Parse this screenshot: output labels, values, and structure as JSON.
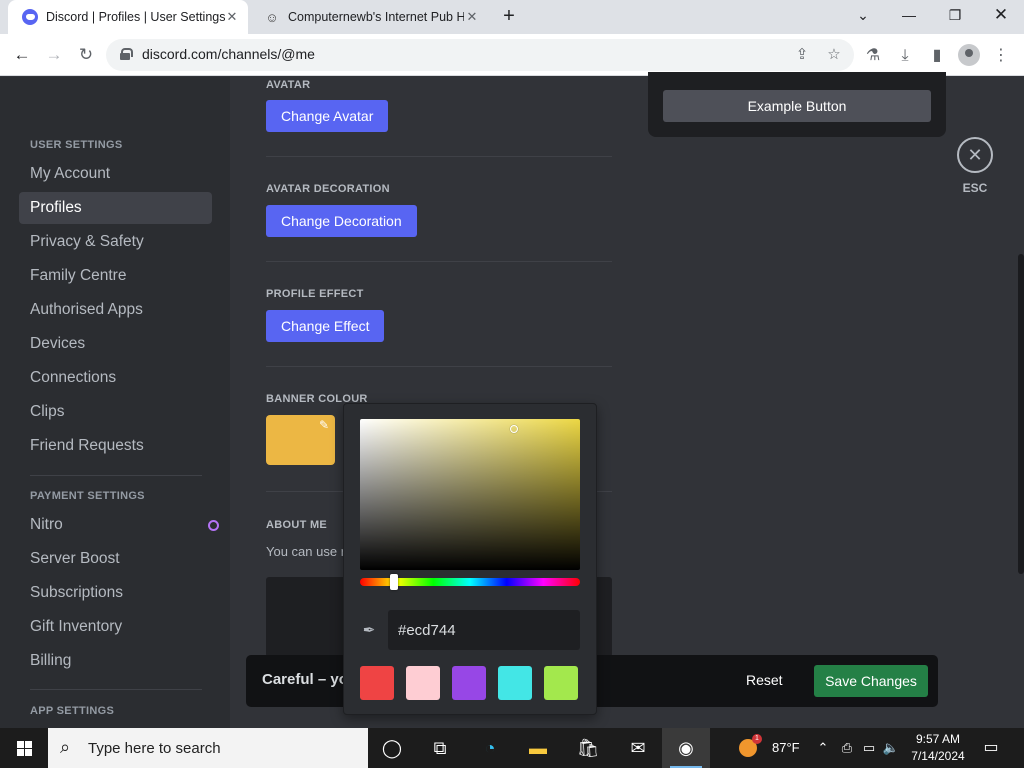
{
  "browser": {
    "tabs": [
      {
        "title": "Discord | Profiles | User Settings",
        "active": true,
        "favicon": "discord-icon"
      },
      {
        "title": "Computernewb's Internet Pub H",
        "active": false,
        "favicon": "pub-icon"
      }
    ],
    "new_tab_label": "+",
    "url": "discord.com/channels/@me"
  },
  "sidebar": {
    "user_settings_header": "USER SETTINGS",
    "user_items": [
      {
        "label": "My Account"
      },
      {
        "label": "Profiles",
        "selected": true
      },
      {
        "label": "Privacy & Safety"
      },
      {
        "label": "Family Centre"
      },
      {
        "label": "Authorised Apps"
      },
      {
        "label": "Devices"
      },
      {
        "label": "Connections"
      },
      {
        "label": "Clips"
      },
      {
        "label": "Friend Requests"
      }
    ],
    "payment_settings_header": "PAYMENT SETTINGS",
    "payment_items": [
      {
        "label": "Nitro"
      },
      {
        "label": "Server Boost"
      },
      {
        "label": "Subscriptions"
      },
      {
        "label": "Gift Inventory"
      },
      {
        "label": "Billing"
      }
    ],
    "app_settings_header": "APP SETTINGS"
  },
  "profile": {
    "avatar_header": "AVATAR",
    "avatar_button": "Change Avatar",
    "decoration_header": "AVATAR DECORATION",
    "decoration_button": "Change Decoration",
    "effect_header": "PROFILE EFFECT",
    "effect_button": "Change Effect",
    "banner_header": "BANNER COLOUR",
    "banner_color": "#ecb744",
    "about_header": "ABOUT ME",
    "about_sub": "You can use r"
  },
  "preview": {
    "example_button": "Example Button"
  },
  "close": {
    "esc_label": "ESC"
  },
  "notice": {
    "text": "Careful – yo",
    "reset_label": "Reset",
    "save_label": "Save Changes"
  },
  "color_picker": {
    "hex_value": "#ecd744",
    "presets": [
      "#ef4444",
      "#fecdd3",
      "#9747e6",
      "#43e6e6",
      "#a3e84d"
    ]
  },
  "taskbar": {
    "search_placeholder": "Type here to search",
    "temperature": "87°F",
    "time": "9:57 AM",
    "date": "7/14/2024",
    "weather_badge": "1"
  },
  "colors": {
    "blurple": "#5865f2",
    "save_green": "#248046",
    "sidebar_bg": "#2b2d31",
    "content_bg": "#313338"
  }
}
